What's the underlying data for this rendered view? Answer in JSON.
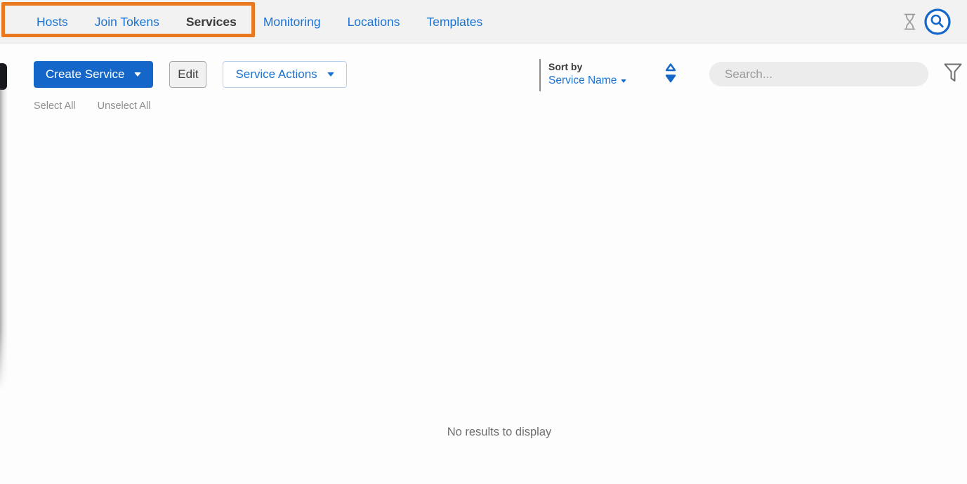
{
  "nav": {
    "tabs": [
      {
        "label": "Hosts",
        "active": false
      },
      {
        "label": "Join Tokens",
        "active": false
      },
      {
        "label": "Services",
        "active": true
      },
      {
        "label": "Monitoring",
        "active": false
      },
      {
        "label": "Locations",
        "active": false
      },
      {
        "label": "Templates",
        "active": false
      }
    ],
    "icons": {
      "hourglass": "hourglass-icon",
      "search_circle": "search-circle-icon"
    }
  },
  "toolbar": {
    "create_service_label": "Create Service",
    "edit_label": "Edit",
    "service_actions_label": "Service Actions",
    "select_all_label": "Select All",
    "unselect_all_label": "Unselect All"
  },
  "sort": {
    "label": "Sort by",
    "value": "Service Name"
  },
  "search": {
    "placeholder": "Search...",
    "value": ""
  },
  "filter": {
    "icon": "filter-funnel-icon"
  },
  "empty_state": {
    "message": "No results to display"
  },
  "annotation": {
    "highlighted_tabs": [
      "Hosts",
      "Join Tokens",
      "Services"
    ],
    "color": "#e8791f"
  },
  "colors": {
    "accent_blue": "#1a72d3",
    "button_blue": "#1467c8",
    "navbar_bg": "#f2f2f2",
    "highlight_orange": "#e8791f"
  }
}
